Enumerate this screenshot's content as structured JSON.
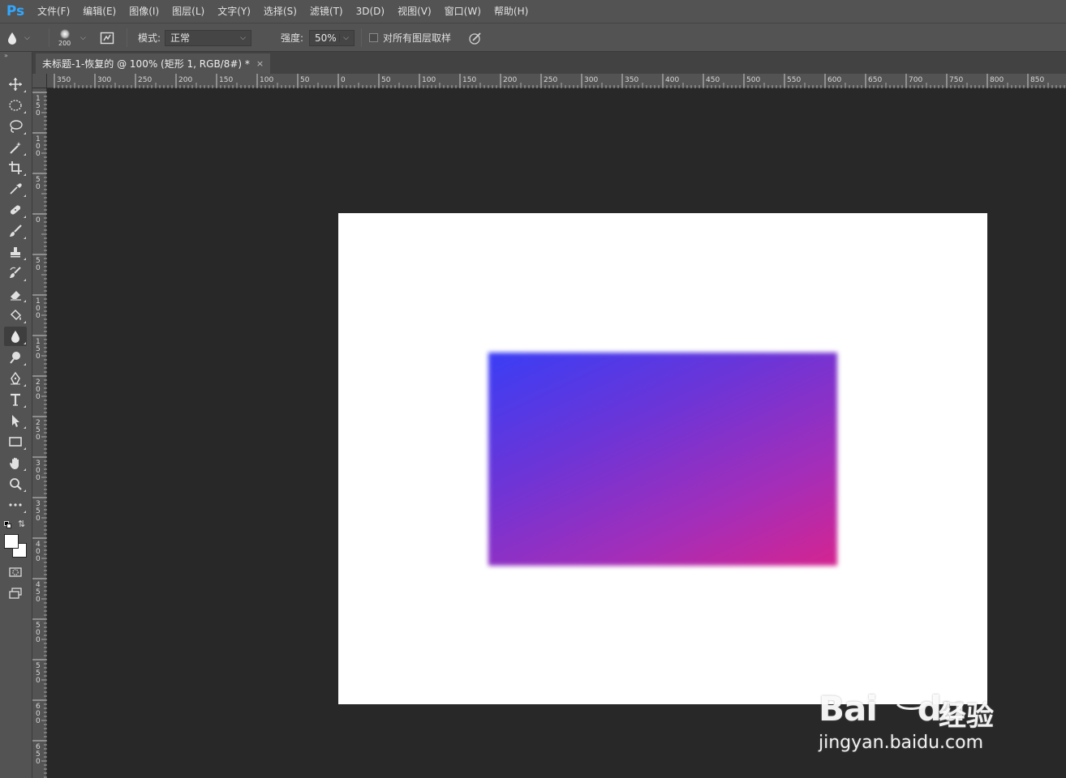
{
  "app": {
    "logo": "Ps",
    "accent_color": "#31a8ff"
  },
  "menu": [
    {
      "label": "文件(F)"
    },
    {
      "label": "编辑(E)"
    },
    {
      "label": "图像(I)"
    },
    {
      "label": "图层(L)"
    },
    {
      "label": "文字(Y)"
    },
    {
      "label": "选择(S)"
    },
    {
      "label": "滤镜(T)"
    },
    {
      "label": "3D(D)"
    },
    {
      "label": "视图(V)"
    },
    {
      "label": "窗口(W)"
    },
    {
      "label": "帮助(H)"
    }
  ],
  "options": {
    "tool_icon": "blur-drop-icon",
    "brush_size": "200",
    "mode_label": "模式:",
    "mode_value": "正常",
    "strength_label": "强度:",
    "strength_value": "50%",
    "sample_all_label": "对所有图层取样",
    "sample_all_checked": false
  },
  "document": {
    "tab_title": "未标题-1-恢复的 @ 100% (矩形 1, RGB/8#) *",
    "close_glyph": "×",
    "gradient_colors": [
      "#3a3ef5",
      "#d52490"
    ]
  },
  "rulers": {
    "horizontal": [
      "350",
      "300",
      "250",
      "200",
      "150",
      "100",
      "50",
      "0",
      "50",
      "100",
      "150",
      "200",
      "250",
      "300",
      "350",
      "400",
      "450",
      "500",
      "550",
      "600",
      "650",
      "700",
      "750",
      "800",
      "850"
    ],
    "vertical": [
      "150",
      "100",
      "50",
      "0",
      "50",
      "100",
      "150",
      "200",
      "250",
      "300",
      "350",
      "400",
      "450",
      "500",
      "550",
      "600",
      "650"
    ]
  },
  "tools": [
    {
      "name": "move-tool",
      "icon": "move-icon"
    },
    {
      "name": "marquee-tool",
      "icon": "ellipse-marquee-icon"
    },
    {
      "name": "lasso-tool",
      "icon": "lasso-icon"
    },
    {
      "name": "magic-wand-tool",
      "icon": "magic-wand-icon"
    },
    {
      "name": "crop-tool",
      "icon": "crop-icon"
    },
    {
      "name": "eyedropper-tool",
      "icon": "eyedropper-icon"
    },
    {
      "name": "healing-brush-tool",
      "icon": "bandage-icon"
    },
    {
      "name": "brush-tool",
      "icon": "brush-icon"
    },
    {
      "name": "clone-stamp-tool",
      "icon": "stamp-icon"
    },
    {
      "name": "history-brush-tool",
      "icon": "history-brush-icon"
    },
    {
      "name": "eraser-tool",
      "icon": "eraser-icon"
    },
    {
      "name": "paint-bucket-tool",
      "icon": "paint-bucket-icon"
    },
    {
      "name": "blur-tool",
      "icon": "blur-drop-icon"
    },
    {
      "name": "dodge-tool",
      "icon": "dodge-icon"
    },
    {
      "name": "pen-tool",
      "icon": "pen-icon"
    },
    {
      "name": "type-tool",
      "icon": "type-icon"
    },
    {
      "name": "path-selection-tool",
      "icon": "arrow-icon"
    },
    {
      "name": "rectangle-tool",
      "icon": "rectangle-icon"
    },
    {
      "name": "hand-tool",
      "icon": "hand-icon"
    },
    {
      "name": "zoom-tool",
      "icon": "zoom-icon"
    },
    {
      "name": "edit-toolbar",
      "icon": "more-icon"
    }
  ],
  "watermark": {
    "brand": "Bai",
    "brand2": "du",
    "cn": "经验",
    "url": "jingyan.baidu.com"
  }
}
